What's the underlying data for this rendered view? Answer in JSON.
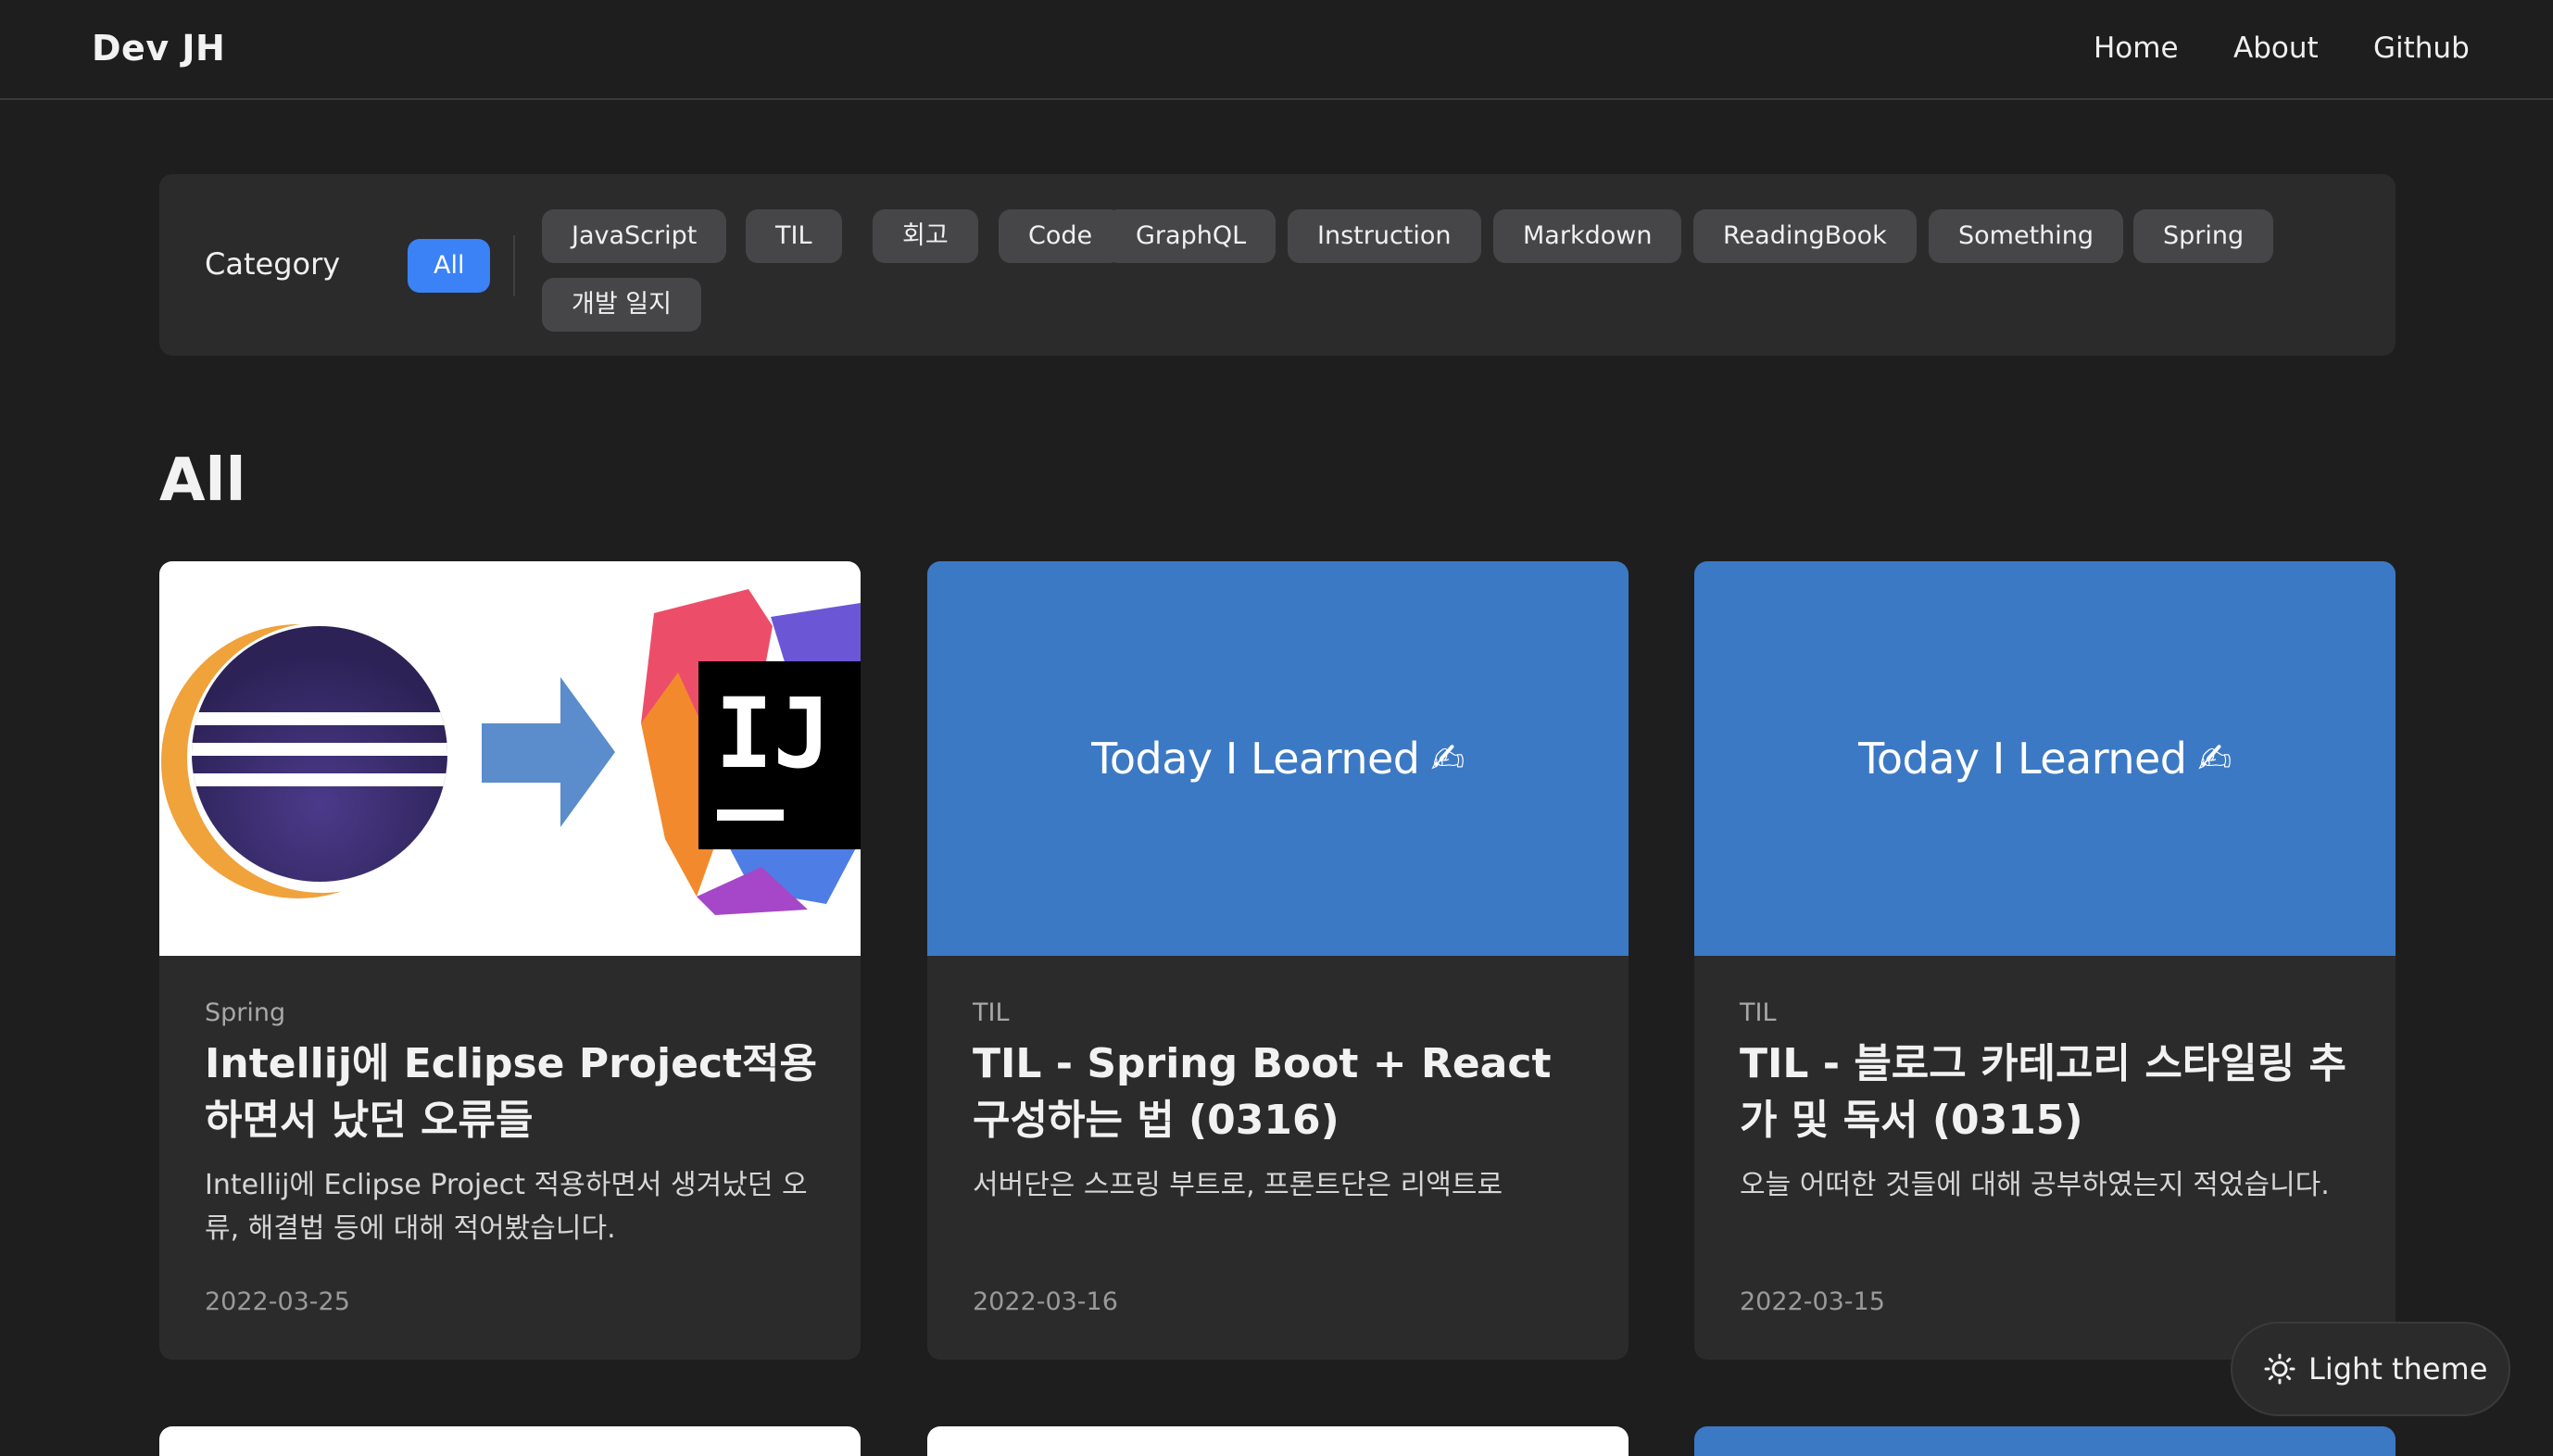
{
  "header": {
    "logo": "Dev JH",
    "nav": [
      "Home",
      "About",
      "Github"
    ]
  },
  "category": {
    "label": "Category",
    "all": "All",
    "chips": [
      "JavaScript",
      "TIL",
      "회고",
      "Code",
      "GraphQL",
      "Instruction",
      "Markdown",
      "ReadingBook",
      "Something",
      "Spring",
      "개발 일지"
    ],
    "active": "All"
  },
  "section_title": "All",
  "posts": [
    {
      "category": "Spring",
      "title": "Intellij에 Eclipse Project적용하면서 났던 오류들",
      "description": "Intellij에 Eclipse Project 적용하면서 생겨났던 오류, 해결법 등에 대해 적어봤습니다.",
      "date": "2022-03-25",
      "thumbnail": "eclipse-to-intellij-image"
    },
    {
      "category": "TIL",
      "title": "TIL - Spring Boot + React 구성하는 법 (0316)",
      "description": "서버단은 스프링 부트로, 프론트단은 리액트로",
      "date": "2022-03-16",
      "thumbnail_text": "Today I Learned",
      "thumbnail_emoji": "✍"
    },
    {
      "category": "TIL",
      "title": "TIL - 블로그 카테고리 스타일링 추가 및 독서 (0315)",
      "description": "오늘 어떠한 것들에 대해 공부하였는지 적었습니다.",
      "date": "2022-03-15",
      "thumbnail_text": "Today I Learned",
      "thumbnail_emoji": "✍"
    }
  ],
  "theme_toggle": {
    "label": "Light theme",
    "icon": "sun-icon"
  },
  "colors": {
    "background": "#1e1e1f",
    "panel": "#2b2b2c",
    "chip": "#464648",
    "accent": "#3b82f6",
    "til_thumbnail": "#3c79c4"
  }
}
